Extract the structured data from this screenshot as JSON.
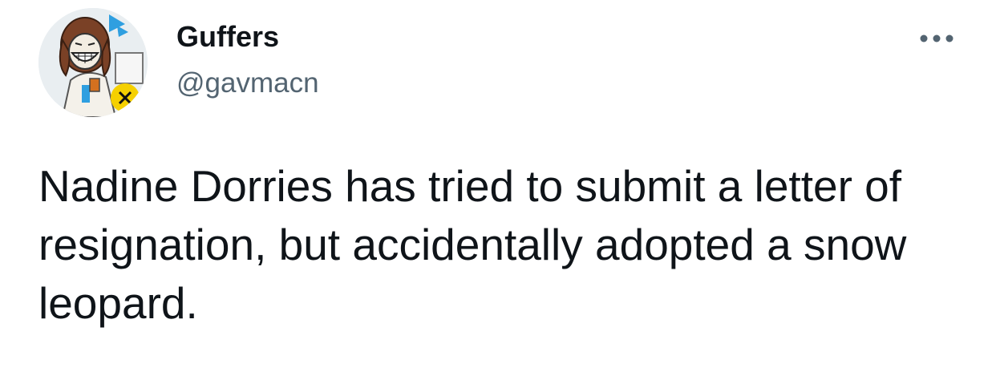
{
  "tweet": {
    "author": {
      "display_name": "Guffers",
      "handle": "@gavmacn",
      "avatar_icon": "cartoon-avatar-icon"
    },
    "more_icon": "more-options-icon",
    "text": "Nadine Dorries has tried to submit a letter of resignation, but accidentally adopted a snow leopard."
  },
  "colors": {
    "background": "#ffffff",
    "text_primary": "#0f1419",
    "text_secondary": "#536471",
    "avatar_accent_blue": "#2f9fe0",
    "avatar_accent_yellow": "#f5d000"
  }
}
